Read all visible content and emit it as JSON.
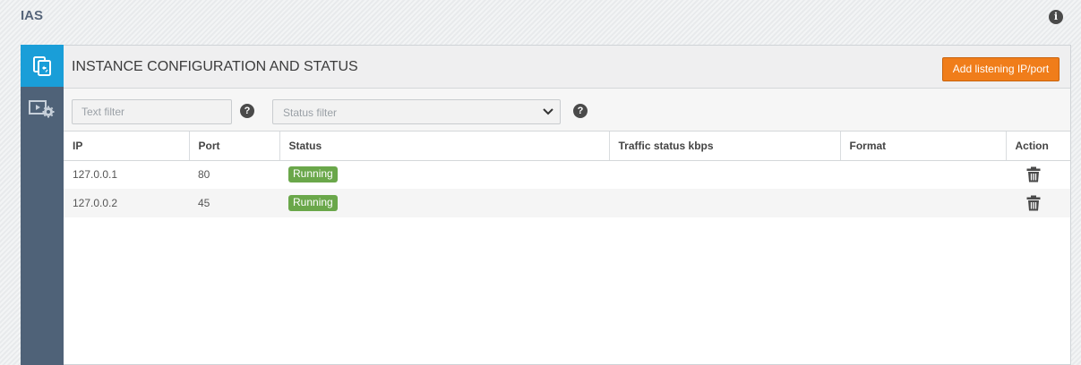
{
  "app": {
    "title": "IAS"
  },
  "sidebar": {
    "items": [
      {
        "name": "instance-config-icon",
        "active": true
      },
      {
        "name": "video-settings-icon",
        "active": false
      }
    ]
  },
  "panel": {
    "title": "INSTANCE CONFIGURATION AND STATUS",
    "add_button_label": "Add listening IP/port"
  },
  "filters": {
    "text_placeholder": "Text filter",
    "status_placeholder": "Status filter",
    "help_glyph": "?"
  },
  "table": {
    "columns": [
      "IP",
      "Port",
      "Status",
      "Traffic status kbps",
      "Format",
      "Action"
    ],
    "rows": [
      {
        "ip": "127.0.0.1",
        "port": "80",
        "status": "Running",
        "traffic": "",
        "format": ""
      },
      {
        "ip": "127.0.0.2",
        "port": "45",
        "status": "Running",
        "traffic": "",
        "format": ""
      }
    ]
  },
  "colors": {
    "accent": "#1a9ed8",
    "sidebar": "#4f6278",
    "button": "#f07d1a",
    "running": "#6aa74a"
  }
}
